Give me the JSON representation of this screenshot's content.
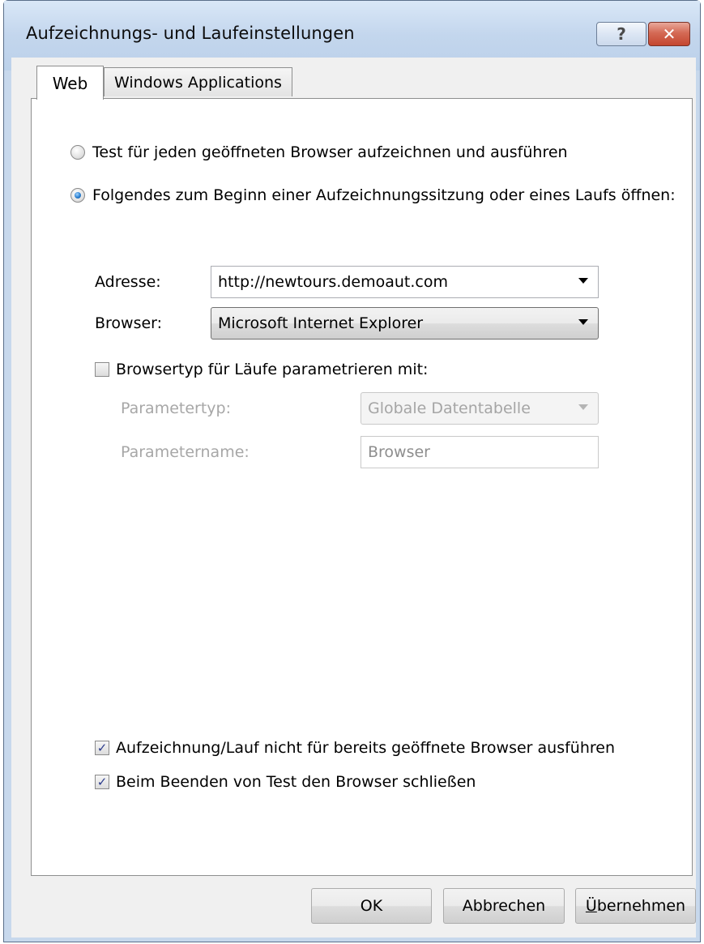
{
  "window": {
    "title": "Aufzeichnungs- und Laufeinstellungen",
    "help_glyph": "?",
    "close_glyph": "✕"
  },
  "tabs": [
    {
      "label": "Web",
      "selected": true
    },
    {
      "label": "Windows Applications",
      "selected": false
    }
  ],
  "web": {
    "radio_any_browser": {
      "label": "Test für jeden geöffneten Browser aufzeichnen und ausführen",
      "checked": false
    },
    "radio_open_at_start": {
      "label": "Folgendes zum Beginn einer Aufzeichnungssitzung oder eines Laufs öffnen:",
      "checked": true
    },
    "address": {
      "label": "Adresse:",
      "value": "http://newtours.demoaut.com"
    },
    "browser": {
      "label": "Browser:",
      "value": "Microsoft Internet Explorer"
    },
    "parametrize": {
      "label": "Browsertyp für Läufe parametrieren mit:",
      "checked": false
    },
    "param_type": {
      "label": "Parametertyp:",
      "value": "Globale Datentabelle"
    },
    "param_name": {
      "label": "Parametername:",
      "value": "Browser"
    },
    "no_record_open_browsers": {
      "label": "Aufzeichnung/Lauf nicht für bereits geöffnete Browser ausführen",
      "checked": true
    },
    "close_browser_on_end": {
      "label": "Beim Beenden von Test den Browser schließen",
      "checked": true
    }
  },
  "buttons": {
    "ok": "OK",
    "cancel": "Abbrechen",
    "apply_first": "Ü",
    "apply_rest": "bernehmen"
  },
  "checkmark": "✓"
}
